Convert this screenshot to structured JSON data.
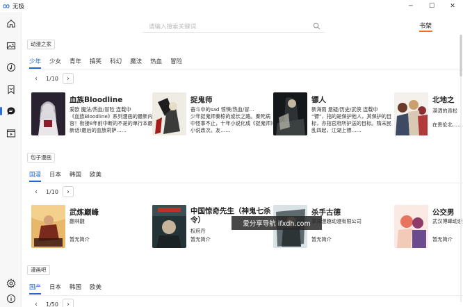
{
  "app": {
    "title": "无极"
  },
  "window": {
    "minimize": "─",
    "maximize": "☐",
    "close": "✕"
  },
  "sidebar": {
    "items": [
      {
        "icon": "home-icon"
      },
      {
        "icon": "image-icon"
      },
      {
        "icon": "music-icon"
      },
      {
        "icon": "bookmark-icon"
      },
      {
        "icon": "comic-icon",
        "active": true
      },
      {
        "icon": "video-icon"
      },
      {
        "icon": "settings-icon"
      },
      {
        "icon": "info-icon"
      }
    ]
  },
  "search": {
    "placeholder": "请输入搜索关键词"
  },
  "shelf": {
    "label": "书架"
  },
  "sections": [
    {
      "source": "动漫之家",
      "tabs": [
        "少年",
        "少女",
        "青年",
        "搞笑",
        "科幻",
        "魔法",
        "热血",
        "冒险"
      ],
      "active_tab": 0,
      "pager": "1/10",
      "cards": [
        {
          "title": "血族Bloodline",
          "lines": [
            "爱欧 魔法/热血/冒险 连载中"
          ],
          "desc": "《血族Bloodline》系列漫画的最新内容！衔接8年前中断的不是的单行本最新话!最后的血族莉萨……"
        },
        {
          "title": "捉鬼师",
          "lines": [
            "奋斗中的sad 惊悚/热血/冒…"
          ],
          "desc": "少年捉鬼师秦椋的成长之路。秦死病中怪事不止，十年小说化成《捉鬼师》小说改次。友……"
        },
        {
          "title": "镖人",
          "lines": [
            "新海雨 悬疑/历史/武侠 连载中"
          ],
          "desc": "“镖”，指的是保护他人，其保护的目标，亦指官府所护送的目标。隋末民乱四起，江湖上镖……"
        },
        {
          "title": "北地之",
          "lines": [
            "漠洒的青松"
          ],
          "desc": "在贵伦北……"
        }
      ]
    },
    {
      "source": "包子漫画",
      "tabs": [
        "国漫",
        "日本",
        "韩国",
        "欧美"
      ],
      "active_tab": 0,
      "pager": "1/10",
      "cards": [
        {
          "title": "武炼巅峰",
          "lines": [
            "翻林翻",
            "暂无简介"
          ]
        },
        {
          "title": "中国惊奇先生（神鬼七杀令）",
          "lines": [
            "权府丹",
            "暂无简介"
          ]
        },
        {
          "title": "杀手古德",
          "lines": [
            "掌阅漫趣动漫有限公司",
            "暂无简介"
          ]
        },
        {
          "title": "公交男",
          "lines": [
            "武汉博峰动漫",
            "暂无简介"
          ]
        }
      ]
    },
    {
      "source": "漫画吧",
      "tabs": [
        "国产",
        "日本",
        "韩国",
        "欧美"
      ],
      "active_tab": 0,
      "pager": "1/50"
    }
  ],
  "watermark": "爱分享导航 ifxdh.com",
  "colors": {
    "accent": "#1e66d0",
    "shelf_underline": "#f2701e"
  }
}
